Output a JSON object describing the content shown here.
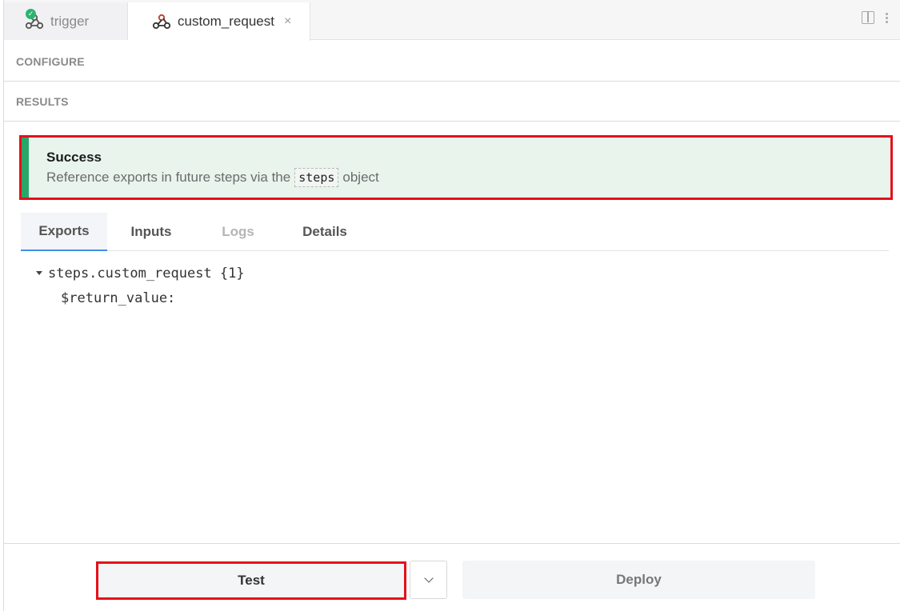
{
  "tabs": [
    {
      "label": "trigger",
      "icon": "webhook-icon",
      "status": "success-check-icon"
    },
    {
      "label": "custom_request",
      "icon": "webhook-icon",
      "close": "×"
    }
  ],
  "sections": {
    "configure": "CONFIGURE",
    "results": "RESULTS"
  },
  "banner": {
    "title": "Success",
    "message_before": "Reference exports in future steps via the",
    "code": "steps",
    "message_after": "object",
    "accent_color": "#2aa66a"
  },
  "result_tabs": [
    "Exports",
    "Inputs",
    "Logs",
    "Details"
  ],
  "tree": {
    "root": "steps.custom_request {1}",
    "child": "$return_value:"
  },
  "footer": {
    "test_label": "Test",
    "deploy_label": "Deploy"
  }
}
